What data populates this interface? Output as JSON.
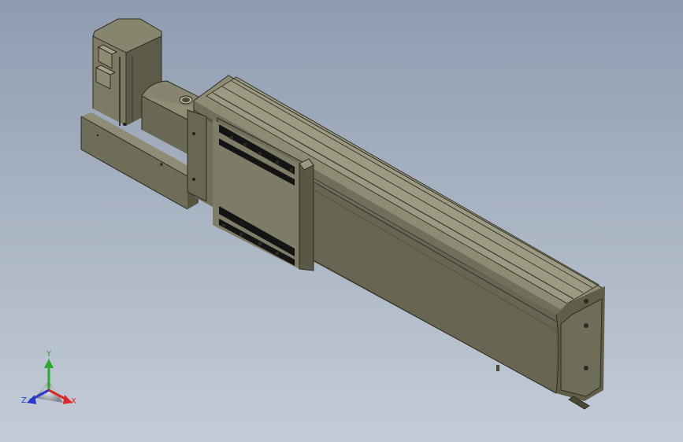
{
  "viewport": {
    "background_top": "#8f9cb0",
    "background_bottom": "#c3ccd6"
  },
  "model": {
    "description_icon": "linear-actuator-with-stepper-motor",
    "body_color": "#767560",
    "body_dark": "#4f4e3e",
    "body_light": "#9c9a82",
    "slot_color": "#141414"
  },
  "triad": {
    "x_label": "X",
    "y_label": "Y",
    "z_label": "Z",
    "x_color": "#e02424",
    "y_color": "#2aa830",
    "z_color": "#2a3ad0"
  }
}
